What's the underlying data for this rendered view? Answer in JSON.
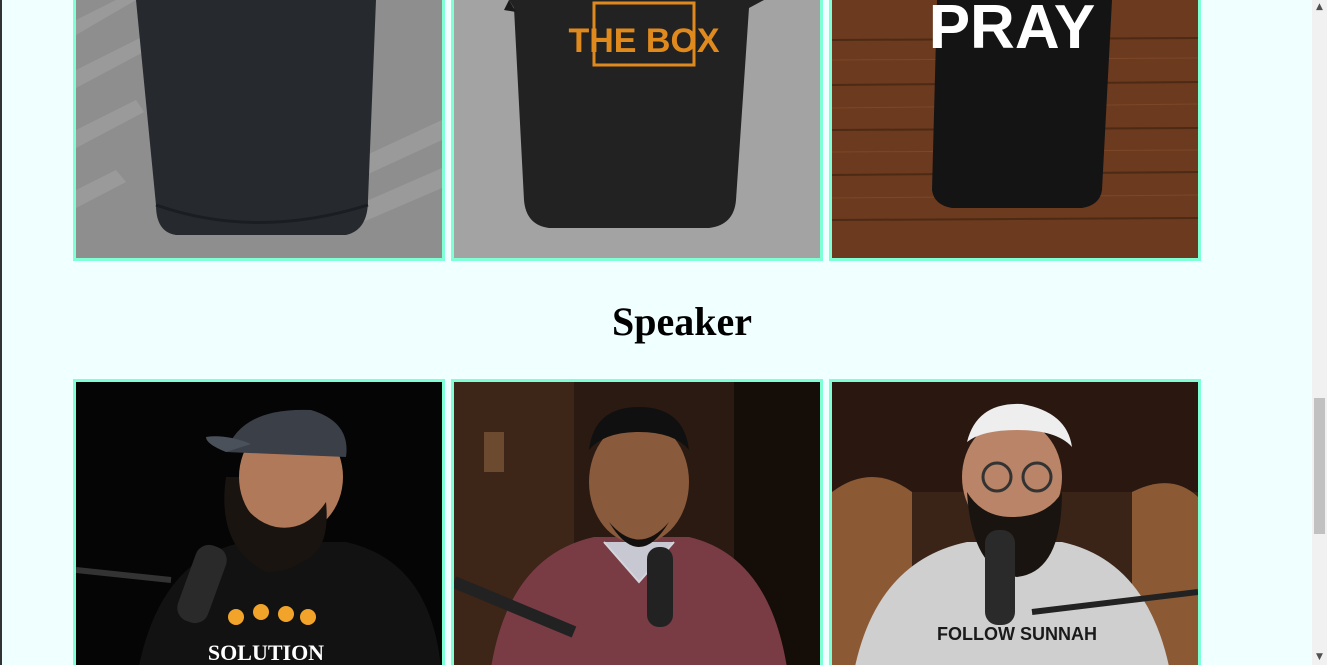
{
  "products": {
    "items": [
      {
        "name": "plain-black-tshirt",
        "print_text": ""
      },
      {
        "name": "outside-the-box-tshirt",
        "print_text": "THE BOX"
      },
      {
        "name": "pray-tshirt",
        "print_text": "PRAY"
      }
    ]
  },
  "speaker_section": {
    "title": "Speaker"
  },
  "speakers": {
    "items": [
      {
        "name": "speaker-1",
        "shirt_text": "SOLUTION"
      },
      {
        "name": "speaker-2",
        "shirt_text": ""
      },
      {
        "name": "speaker-3",
        "shirt_text": "FOLLOW SUNNAH"
      }
    ]
  },
  "colors": {
    "page_background": "#f0ffff",
    "card_border": "#7fffd4"
  },
  "scrollbar": {
    "up_icon": "arrow-up-icon",
    "down_icon": "arrow-down-icon"
  }
}
